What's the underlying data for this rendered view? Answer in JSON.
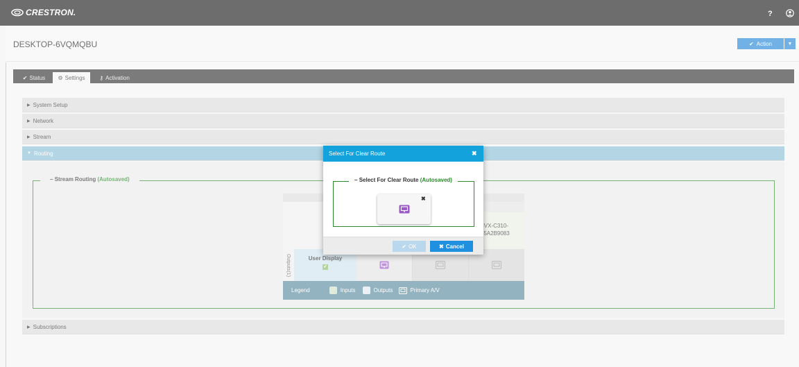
{
  "brand": {
    "name": "CRESTRON.",
    "help_label": "?"
  },
  "header": {
    "device_name": "DESKTOP-6VQMQBU",
    "action_label": "Action"
  },
  "tabs": [
    {
      "label": "Status",
      "icon": "check-icon"
    },
    {
      "label": "Settings",
      "icon": "gear-icon"
    },
    {
      "label": "Activation",
      "icon": "key-icon"
    }
  ],
  "accordion": [
    {
      "label": "System Setup",
      "expanded": false
    },
    {
      "label": "Network",
      "expanded": false
    },
    {
      "label": "Stream",
      "expanded": false
    },
    {
      "label": "Routing",
      "expanded": true
    },
    {
      "label": "Subscriptions",
      "expanded": false
    }
  ],
  "routing": {
    "section_title": "Stream Routing",
    "autosaved": "(Autosaved)",
    "input_name_line1": "NVX-C310-",
    "input_name_line2": "B5A2B9083",
    "outputs_label": "Outputs(1)",
    "output_name": "User Display",
    "legend": {
      "title": "Legend",
      "inputs": "Inputs",
      "outputs": "Outputs",
      "primary": "Primary A/V"
    }
  },
  "modal": {
    "title": "Select For Clear Route",
    "fieldset_title": "Select For Clear Route",
    "autosaved": "(Autosaved)",
    "ok_label": "OK",
    "cancel_label": "Cancel"
  },
  "colors": {
    "accent": "#14a2dd",
    "action": "#2688d8",
    "autosaved": "#2a8a2a",
    "route_icon": "#9b59c6"
  }
}
